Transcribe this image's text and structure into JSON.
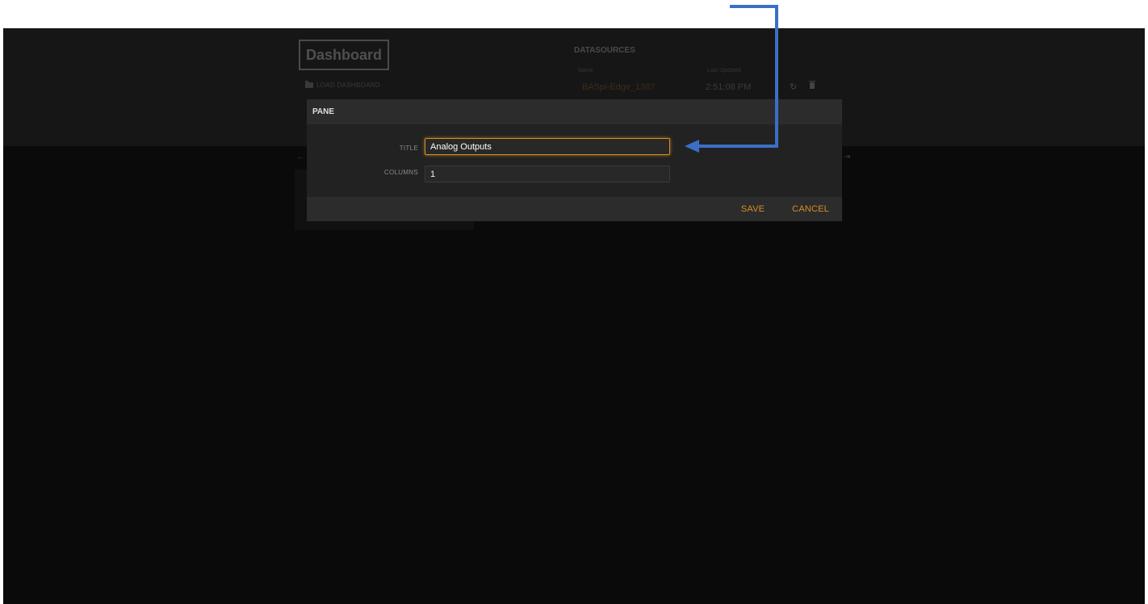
{
  "dashboard": {
    "logo": "Dashboard",
    "load_label": "LOAD DASHBOARD"
  },
  "datasources": {
    "title": "DATASOURCES",
    "columns": {
      "name": "Name",
      "last_updated": "Last Updated"
    },
    "rows": [
      {
        "name": "BASpi-Edge_1387",
        "last_updated": "2:51:08 PM"
      }
    ]
  },
  "modal": {
    "title": "PANE",
    "fields": {
      "title_label": "TITLE",
      "title_value": "Analog Outputs",
      "columns_label": "COLUMNS",
      "columns_value": "1"
    },
    "save_label": "SAVE",
    "cancel_label": "CANCEL"
  },
  "colors": {
    "accent": "#d68f22",
    "annotation_arrow": "#3b6fc6",
    "modal_bg": "#242424",
    "overlay_bg": "#0a0a0a"
  },
  "icons": [
    "folder-icon",
    "refresh-icon",
    "trash-icon",
    "arrow-left-icon",
    "arrow-right-icon",
    "annotation-arrow-icon"
  ]
}
